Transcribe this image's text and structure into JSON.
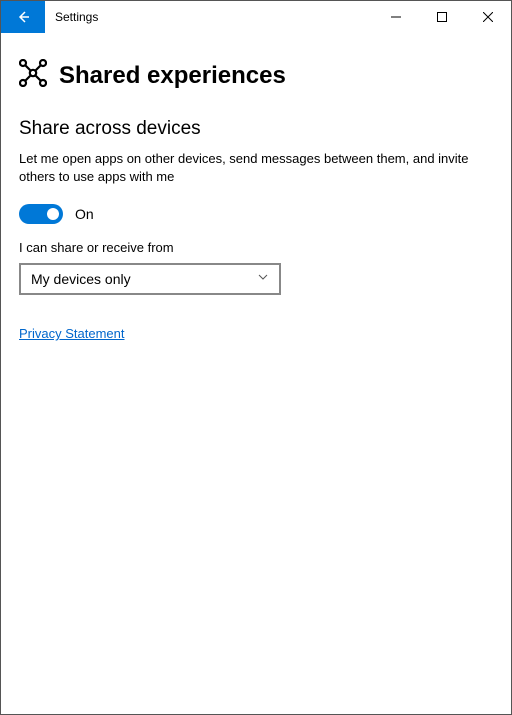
{
  "titlebar": {
    "title": "Settings"
  },
  "page": {
    "header": "Shared experiences"
  },
  "section": {
    "title": "Share across devices",
    "description": "Let me open apps on other devices, send messages between them, and invite others to use apps with me"
  },
  "toggle": {
    "state_label": "On"
  },
  "scope": {
    "label": "I can share or receive from",
    "selected": "My devices only"
  },
  "links": {
    "privacy": "Privacy Statement"
  }
}
